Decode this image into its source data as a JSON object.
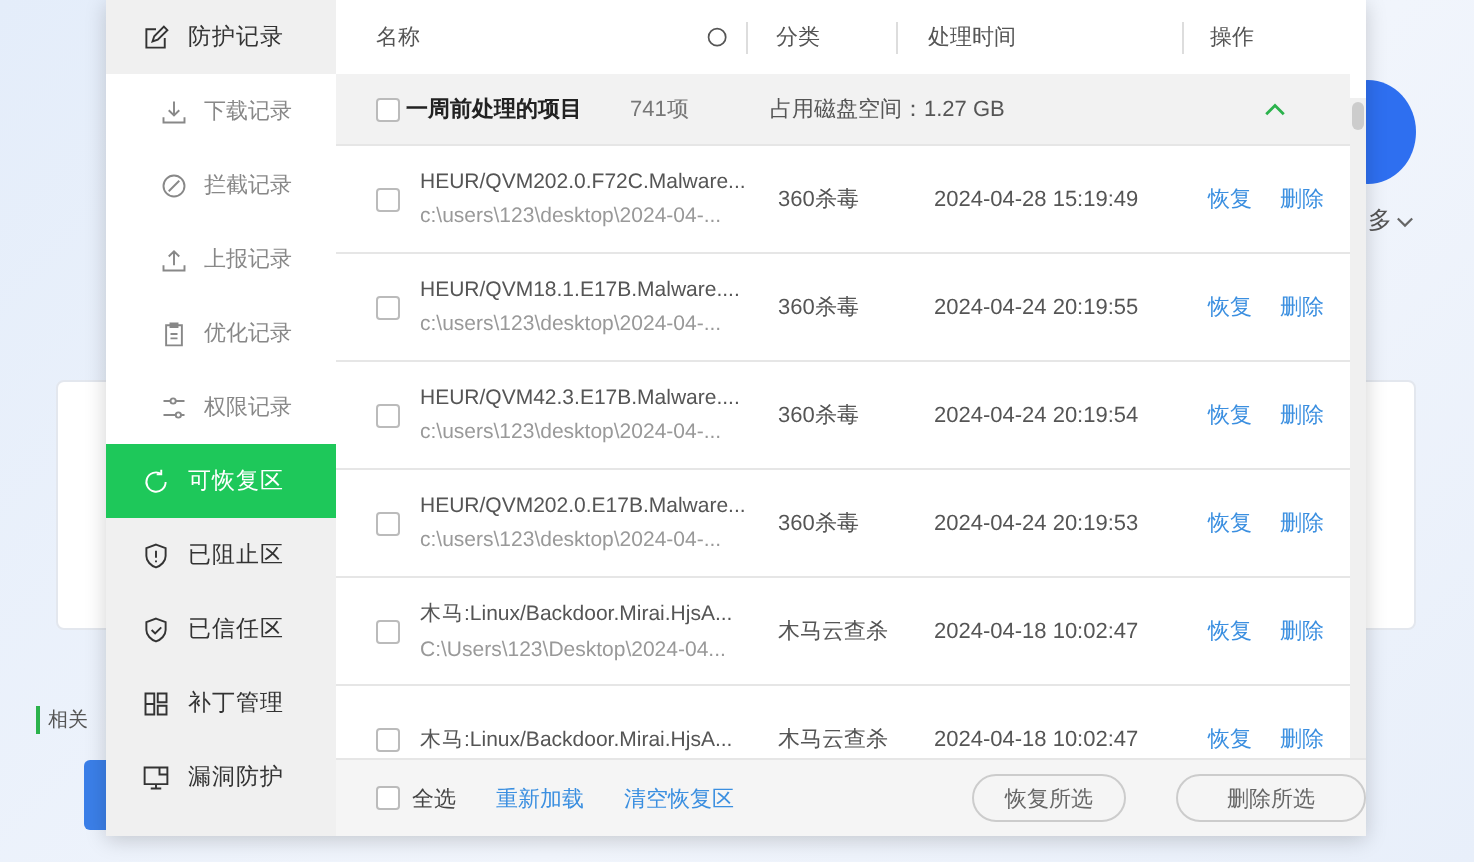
{
  "background": {
    "more_link": "多",
    "section_title": "相关"
  },
  "sidebar": {
    "items": [
      {
        "label": "防护记录",
        "selected": false,
        "expanded": true,
        "children": [
          {
            "label": "下载记录",
            "selected": false
          },
          {
            "label": "拦截记录",
            "selected": false
          },
          {
            "label": "上报记录",
            "selected": false
          },
          {
            "label": "优化记录",
            "selected": false
          },
          {
            "label": "权限记录",
            "selected": false
          }
        ]
      },
      {
        "label": "可恢复区",
        "selected": true
      },
      {
        "label": "已阻止区",
        "selected": false
      },
      {
        "label": "已信任区",
        "selected": false
      },
      {
        "label": "补丁管理",
        "selected": false
      },
      {
        "label": "漏洞防护",
        "selected": false
      }
    ]
  },
  "table": {
    "columns": [
      "名称",
      "分类",
      "处理时间",
      "操作"
    ],
    "group": {
      "label": "一周前处理的项目",
      "count": "741项",
      "disk_usage": "占用磁盘空间：1.27 GB",
      "checked": false,
      "expanded": true
    },
    "rows": [
      {
        "name": "HEUR/QVM202.0.F72C.Malware...",
        "path": "c:\\users\\123\\desktop\\2024-04-...",
        "category": "360杀毒",
        "time": "2024-04-28 15:19:49",
        "actions": [
          "恢复",
          "删除"
        ],
        "checked": false
      },
      {
        "name": "HEUR/QVM18.1.E17B.Malware....",
        "path": "c:\\users\\123\\desktop\\2024-04-...",
        "category": "360杀毒",
        "time": "2024-04-24 20:19:55",
        "actions": [
          "恢复",
          "删除"
        ],
        "checked": false
      },
      {
        "name": "HEUR/QVM42.3.E17B.Malware....",
        "path": "c:\\users\\123\\desktop\\2024-04-...",
        "category": "360杀毒",
        "time": "2024-04-24 20:19:54",
        "actions": [
          "恢复",
          "删除"
        ],
        "checked": false
      },
      {
        "name": "HEUR/QVM202.0.E17B.Malware...",
        "path": "c:\\users\\123\\desktop\\2024-04-...",
        "category": "360杀毒",
        "time": "2024-04-24 20:19:53",
        "actions": [
          "恢复",
          "删除"
        ],
        "checked": false
      },
      {
        "name": "木马:Linux/Backdoor.Mirai.HjsA...",
        "path": "C:\\Users\\123\\Desktop\\2024-04...",
        "category": "木马云查杀",
        "time": "2024-04-18 10:02:47",
        "actions": [
          "恢复",
          "删除"
        ],
        "checked": false
      },
      {
        "name": "木马:Linux/Backdoor.Mirai.HjsA...",
        "category": "木马云查杀",
        "time": "2024-04-18 10:02:47",
        "actions": [
          "恢复",
          "删除"
        ],
        "checked": false
      }
    ]
  },
  "footer": {
    "select_all": {
      "label": "全选",
      "checked": false
    },
    "links": [
      "重新加载",
      "清空恢复区"
    ],
    "buttons": [
      "恢复所选",
      "删除所选"
    ]
  }
}
